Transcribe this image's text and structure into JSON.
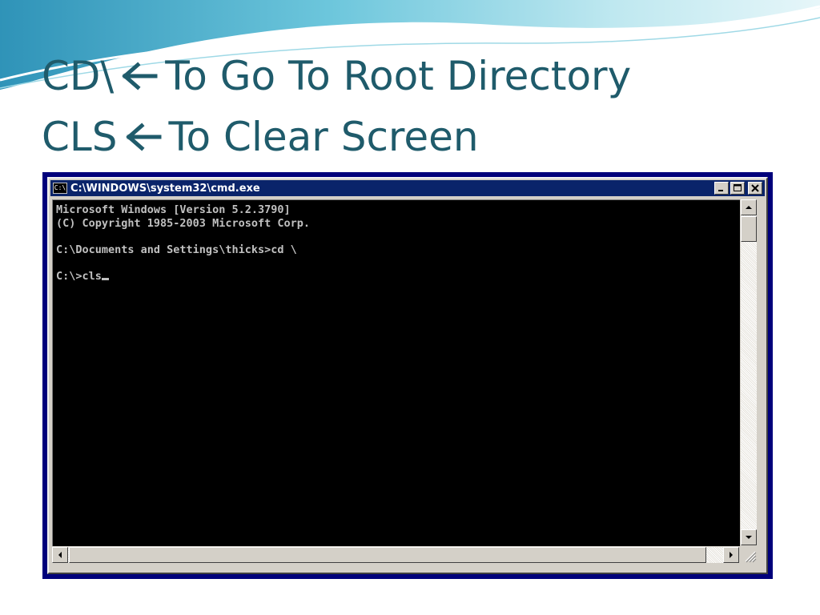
{
  "slide": {
    "line1": {
      "command": "CD\\",
      "text": "To Go To Root Directory"
    },
    "line2": {
      "command": "CLS",
      "text": "To Clear Screen"
    },
    "arrow_icon": "left-arrow-icon",
    "title_color": "#1f5b6b"
  },
  "window": {
    "title": "C:\\WINDOWS\\system32\\cmd.exe",
    "icon_text": "C:\\",
    "titlebar_color": "#0a246a",
    "frame_color": "#00007b",
    "buttons": [
      "minimize-icon",
      "maximize-icon",
      "close-icon"
    ]
  },
  "console": {
    "lines": [
      "Microsoft Windows [Version 5.2.3790]",
      "(C) Copyright 1985-2003 Microsoft Corp.",
      "",
      "C:\\Documents and Settings\\thicks>cd \\",
      "",
      "C:\\>cls"
    ],
    "text_color": "#c0c0c0",
    "background": "#000000"
  }
}
